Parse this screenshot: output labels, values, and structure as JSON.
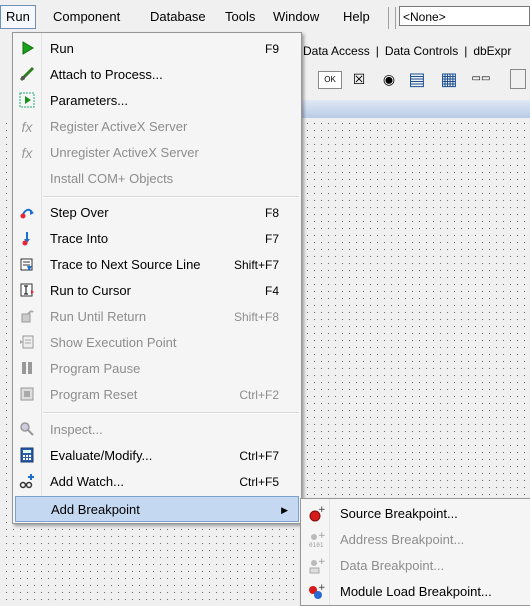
{
  "menubar": {
    "items": [
      "Run",
      "Component",
      "Database",
      "Tools",
      "Window",
      "Help"
    ],
    "combo_value": "<None>"
  },
  "palette": {
    "tabs": [
      "Data Access",
      "|",
      "Data Controls",
      "|",
      "dbExpr"
    ]
  },
  "run_menu": {
    "items": [
      {
        "label": "Run",
        "shortcut": "F9",
        "icon": "run-icon",
        "disabled": false
      },
      {
        "label": "Attach to Process...",
        "shortcut": "",
        "icon": "attach-icon",
        "disabled": false
      },
      {
        "label": "Parameters...",
        "shortcut": "",
        "icon": "parameters-icon",
        "disabled": false
      },
      {
        "label": "Register ActiveX Server",
        "shortcut": "",
        "icon": "register-activex-icon",
        "disabled": true
      },
      {
        "label": "Unregister ActiveX Server",
        "shortcut": "",
        "icon": "unregister-activex-icon",
        "disabled": true
      },
      {
        "label": "Install COM+ Objects",
        "shortcut": "",
        "icon": "",
        "disabled": true
      },
      {
        "label": "Step Over",
        "shortcut": "F8",
        "icon": "step-over-icon",
        "disabled": false
      },
      {
        "label": "Trace Into",
        "shortcut": "F7",
        "icon": "trace-into-icon",
        "disabled": false
      },
      {
        "label": "Trace to Next Source Line",
        "shortcut": "Shift+F7",
        "icon": "trace-next-line-icon",
        "disabled": false
      },
      {
        "label": "Run to Cursor",
        "shortcut": "F4",
        "icon": "run-to-cursor-icon",
        "disabled": false
      },
      {
        "label": "Run Until Return",
        "shortcut": "Shift+F8",
        "icon": "run-until-return-icon",
        "disabled": true
      },
      {
        "label": "Show Execution Point",
        "shortcut": "",
        "icon": "show-execution-point-icon",
        "disabled": true
      },
      {
        "label": "Program Pause",
        "shortcut": "",
        "icon": "pause-icon",
        "disabled": true
      },
      {
        "label": "Program Reset",
        "shortcut": "Ctrl+F2",
        "icon": "reset-icon",
        "disabled": true
      },
      {
        "label": "Inspect...",
        "shortcut": "",
        "icon": "inspect-icon",
        "disabled": true
      },
      {
        "label": "Evaluate/Modify...",
        "shortcut": "Ctrl+F7",
        "icon": "evaluate-icon",
        "disabled": false
      },
      {
        "label": "Add Watch...",
        "shortcut": "Ctrl+F5",
        "icon": "add-watch-icon",
        "disabled": false
      },
      {
        "label": "Add Breakpoint",
        "shortcut": "",
        "icon": "",
        "disabled": false,
        "highlighted": true,
        "submenu": true
      }
    ]
  },
  "breakpoint_submenu": {
    "items": [
      {
        "label": "Source Breakpoint...",
        "icon": "source-breakpoint-icon",
        "disabled": false
      },
      {
        "label": "Address Breakpoint...",
        "icon": "address-breakpoint-icon",
        "disabled": true
      },
      {
        "label": "Data Breakpoint...",
        "icon": "data-breakpoint-icon",
        "disabled": true
      },
      {
        "label": "Module Load Breakpoint...",
        "icon": "module-load-breakpoint-icon",
        "disabled": false
      }
    ]
  },
  "tool_palette": {
    "buttons": [
      "OK"
    ]
  }
}
